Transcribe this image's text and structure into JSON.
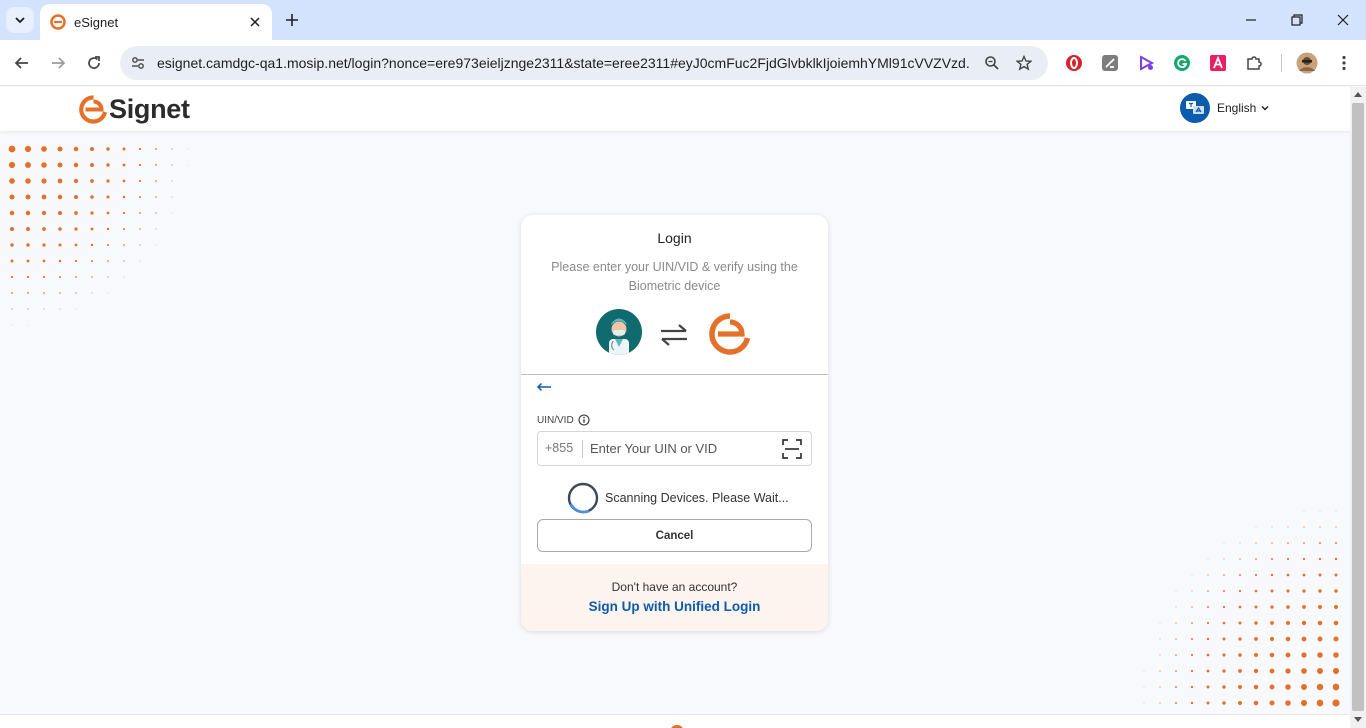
{
  "browser": {
    "tab": {
      "title": "eSignet"
    },
    "omnibox": {
      "url": "esignet.camdgc-qa1.mosip.net/login?nonce=ere973eieljznge2311&state=eree2311#eyJ0cmFuc2FjdGlvbklkIjoiemhYMl91cVVZVzd..."
    },
    "toolbar": {
      "back": "back-arrow-icon",
      "forward": "forward-arrow-icon",
      "reload": "reload-icon",
      "extensions": [
        "opera-ad-blocker-icon",
        "notes-extension-icon",
        "video-extension-icon",
        "grammarly-icon",
        "acrobat-icon",
        "puzzle-extensions-icon",
        "profile-avatar-icon",
        "more-menu-icon"
      ]
    }
  },
  "site": {
    "logo_text": "Signet",
    "language": {
      "label": "English"
    },
    "colors": {
      "brand_orange": "#e5702a",
      "primary_blue": "#0b5cad"
    }
  },
  "login": {
    "title": "Login",
    "subtitle": "Please enter your UIN/VID & verify using the Biometric device",
    "field_label": "UIN/VID",
    "country_code": "+855",
    "input_placeholder": "Enter Your UIN or VID",
    "input_value": "",
    "scanning_text": "Scanning Devices. Please Wait...",
    "cancel_label": "Cancel",
    "footer": {
      "question": "Don't have an account?",
      "signup_link": "Sign Up with Unified Login"
    }
  }
}
